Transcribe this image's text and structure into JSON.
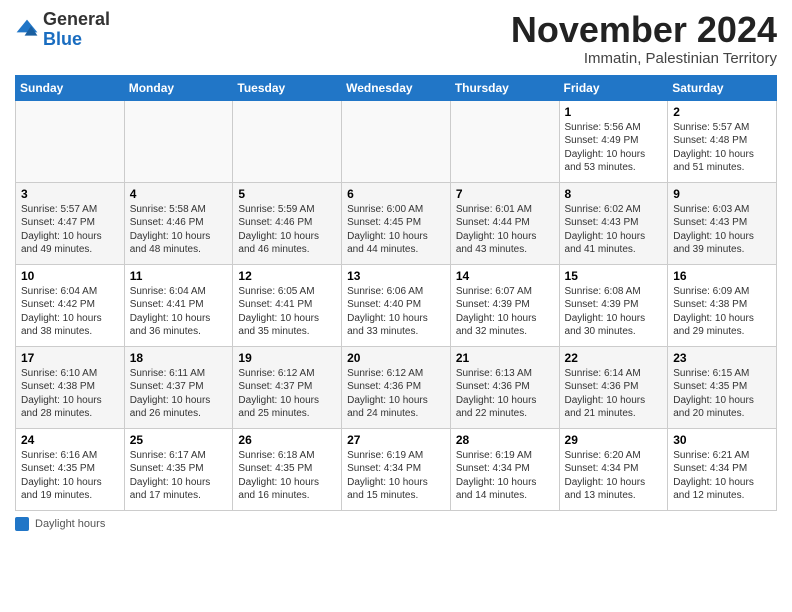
{
  "header": {
    "logo": {
      "general": "General",
      "blue": "Blue"
    },
    "title": "November 2024",
    "subtitle": "Immatin, Palestinian Territory"
  },
  "calendar": {
    "days_of_week": [
      "Sunday",
      "Monday",
      "Tuesday",
      "Wednesday",
      "Thursday",
      "Friday",
      "Saturday"
    ],
    "weeks": [
      [
        {
          "day": "",
          "info": ""
        },
        {
          "day": "",
          "info": ""
        },
        {
          "day": "",
          "info": ""
        },
        {
          "day": "",
          "info": ""
        },
        {
          "day": "",
          "info": ""
        },
        {
          "day": "1",
          "info": "Sunrise: 5:56 AM\nSunset: 4:49 PM\nDaylight: 10 hours and 53 minutes."
        },
        {
          "day": "2",
          "info": "Sunrise: 5:57 AM\nSunset: 4:48 PM\nDaylight: 10 hours and 51 minutes."
        }
      ],
      [
        {
          "day": "3",
          "info": "Sunrise: 5:57 AM\nSunset: 4:47 PM\nDaylight: 10 hours and 49 minutes."
        },
        {
          "day": "4",
          "info": "Sunrise: 5:58 AM\nSunset: 4:46 PM\nDaylight: 10 hours and 48 minutes."
        },
        {
          "day": "5",
          "info": "Sunrise: 5:59 AM\nSunset: 4:46 PM\nDaylight: 10 hours and 46 minutes."
        },
        {
          "day": "6",
          "info": "Sunrise: 6:00 AM\nSunset: 4:45 PM\nDaylight: 10 hours and 44 minutes."
        },
        {
          "day": "7",
          "info": "Sunrise: 6:01 AM\nSunset: 4:44 PM\nDaylight: 10 hours and 43 minutes."
        },
        {
          "day": "8",
          "info": "Sunrise: 6:02 AM\nSunset: 4:43 PM\nDaylight: 10 hours and 41 minutes."
        },
        {
          "day": "9",
          "info": "Sunrise: 6:03 AM\nSunset: 4:43 PM\nDaylight: 10 hours and 39 minutes."
        }
      ],
      [
        {
          "day": "10",
          "info": "Sunrise: 6:04 AM\nSunset: 4:42 PM\nDaylight: 10 hours and 38 minutes."
        },
        {
          "day": "11",
          "info": "Sunrise: 6:04 AM\nSunset: 4:41 PM\nDaylight: 10 hours and 36 minutes."
        },
        {
          "day": "12",
          "info": "Sunrise: 6:05 AM\nSunset: 4:41 PM\nDaylight: 10 hours and 35 minutes."
        },
        {
          "day": "13",
          "info": "Sunrise: 6:06 AM\nSunset: 4:40 PM\nDaylight: 10 hours and 33 minutes."
        },
        {
          "day": "14",
          "info": "Sunrise: 6:07 AM\nSunset: 4:39 PM\nDaylight: 10 hours and 32 minutes."
        },
        {
          "day": "15",
          "info": "Sunrise: 6:08 AM\nSunset: 4:39 PM\nDaylight: 10 hours and 30 minutes."
        },
        {
          "day": "16",
          "info": "Sunrise: 6:09 AM\nSunset: 4:38 PM\nDaylight: 10 hours and 29 minutes."
        }
      ],
      [
        {
          "day": "17",
          "info": "Sunrise: 6:10 AM\nSunset: 4:38 PM\nDaylight: 10 hours and 28 minutes."
        },
        {
          "day": "18",
          "info": "Sunrise: 6:11 AM\nSunset: 4:37 PM\nDaylight: 10 hours and 26 minutes."
        },
        {
          "day": "19",
          "info": "Sunrise: 6:12 AM\nSunset: 4:37 PM\nDaylight: 10 hours and 25 minutes."
        },
        {
          "day": "20",
          "info": "Sunrise: 6:12 AM\nSunset: 4:36 PM\nDaylight: 10 hours and 24 minutes."
        },
        {
          "day": "21",
          "info": "Sunrise: 6:13 AM\nSunset: 4:36 PM\nDaylight: 10 hours and 22 minutes."
        },
        {
          "day": "22",
          "info": "Sunrise: 6:14 AM\nSunset: 4:36 PM\nDaylight: 10 hours and 21 minutes."
        },
        {
          "day": "23",
          "info": "Sunrise: 6:15 AM\nSunset: 4:35 PM\nDaylight: 10 hours and 20 minutes."
        }
      ],
      [
        {
          "day": "24",
          "info": "Sunrise: 6:16 AM\nSunset: 4:35 PM\nDaylight: 10 hours and 19 minutes."
        },
        {
          "day": "25",
          "info": "Sunrise: 6:17 AM\nSunset: 4:35 PM\nDaylight: 10 hours and 17 minutes."
        },
        {
          "day": "26",
          "info": "Sunrise: 6:18 AM\nSunset: 4:35 PM\nDaylight: 10 hours and 16 minutes."
        },
        {
          "day": "27",
          "info": "Sunrise: 6:19 AM\nSunset: 4:34 PM\nDaylight: 10 hours and 15 minutes."
        },
        {
          "day": "28",
          "info": "Sunrise: 6:19 AM\nSunset: 4:34 PM\nDaylight: 10 hours and 14 minutes."
        },
        {
          "day": "29",
          "info": "Sunrise: 6:20 AM\nSunset: 4:34 PM\nDaylight: 10 hours and 13 minutes."
        },
        {
          "day": "30",
          "info": "Sunrise: 6:21 AM\nSunset: 4:34 PM\nDaylight: 10 hours and 12 minutes."
        }
      ]
    ]
  },
  "legend": {
    "label": "Daylight hours"
  }
}
